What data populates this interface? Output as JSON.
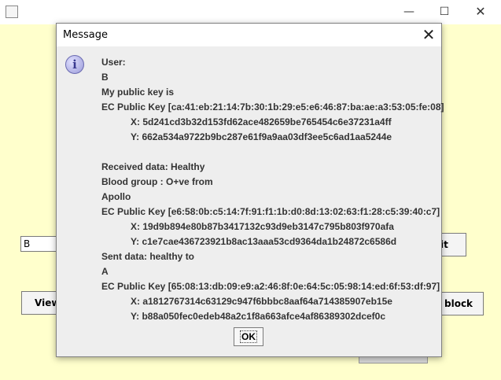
{
  "main_window": {
    "minimize_glyph": "—",
    "maximize_glyph": "☐",
    "close_glyph": "✕",
    "user_field_value": "B",
    "view_button_label": "View",
    "submit_button_label": "it",
    "block_button_label": "block",
    "background_color": "#ffffcc"
  },
  "dialog": {
    "title": "Message",
    "close_glyph": "✕",
    "icon": "info-icon",
    "icon_glyph": "i",
    "lines": [
      {
        "text": "User:",
        "indent": false
      },
      {
        "text": "B",
        "indent": false
      },
      {
        "text": "My public key is",
        "indent": false
      },
      {
        "text": "EC Public Key [ca:41:eb:21:14:7b:30:1b:29:e5:e6:46:87:ba:ae:a3:53:05:fe:08]",
        "indent": false
      },
      {
        "text": "X: 5d241cd3b32d153fd62ace482659be765454c6e37231a4ff",
        "indent": true
      },
      {
        "text": "Y: 662a534a9722b9bc287e61f9a9aa03df3ee5c6ad1aa5244e",
        "indent": true
      },
      {
        "text": "",
        "indent": false
      },
      {
        "text": "Received data: Healthy",
        "indent": false
      },
      {
        "text": "Blood group : O+ve from",
        "indent": false
      },
      {
        "text": "Apollo",
        "indent": false
      },
      {
        "text": "EC Public Key [e6:58:0b:c5:14:7f:91:f1:1b:d0:8d:13:02:63:f1:28:c5:39:40:c7]",
        "indent": false
      },
      {
        "text": "X: 19d9b894e80b87b3417132c93d9eb3147c795b803f970afa",
        "indent": true
      },
      {
        "text": "Y: c1e7cae436723921b8ac13aaa53cd9364da1b24872c6586d",
        "indent": true
      },
      {
        "text": "Sent data: healthy to",
        "indent": false
      },
      {
        "text": "A",
        "indent": false
      },
      {
        "text": "EC Public Key [65:08:13:db:09:e9:a2:46:8f:0e:64:5c:05:98:14:ed:6f:53:df:97]",
        "indent": false
      },
      {
        "text": "X: a1812767314c63129c947f6bbbc8aaf64a714385907eb15e",
        "indent": true
      },
      {
        "text": "Y: b88a050fec0edeb48a2c1f8a663afce4af86389302dcef0c",
        "indent": true
      }
    ],
    "ok_label": "OK"
  }
}
